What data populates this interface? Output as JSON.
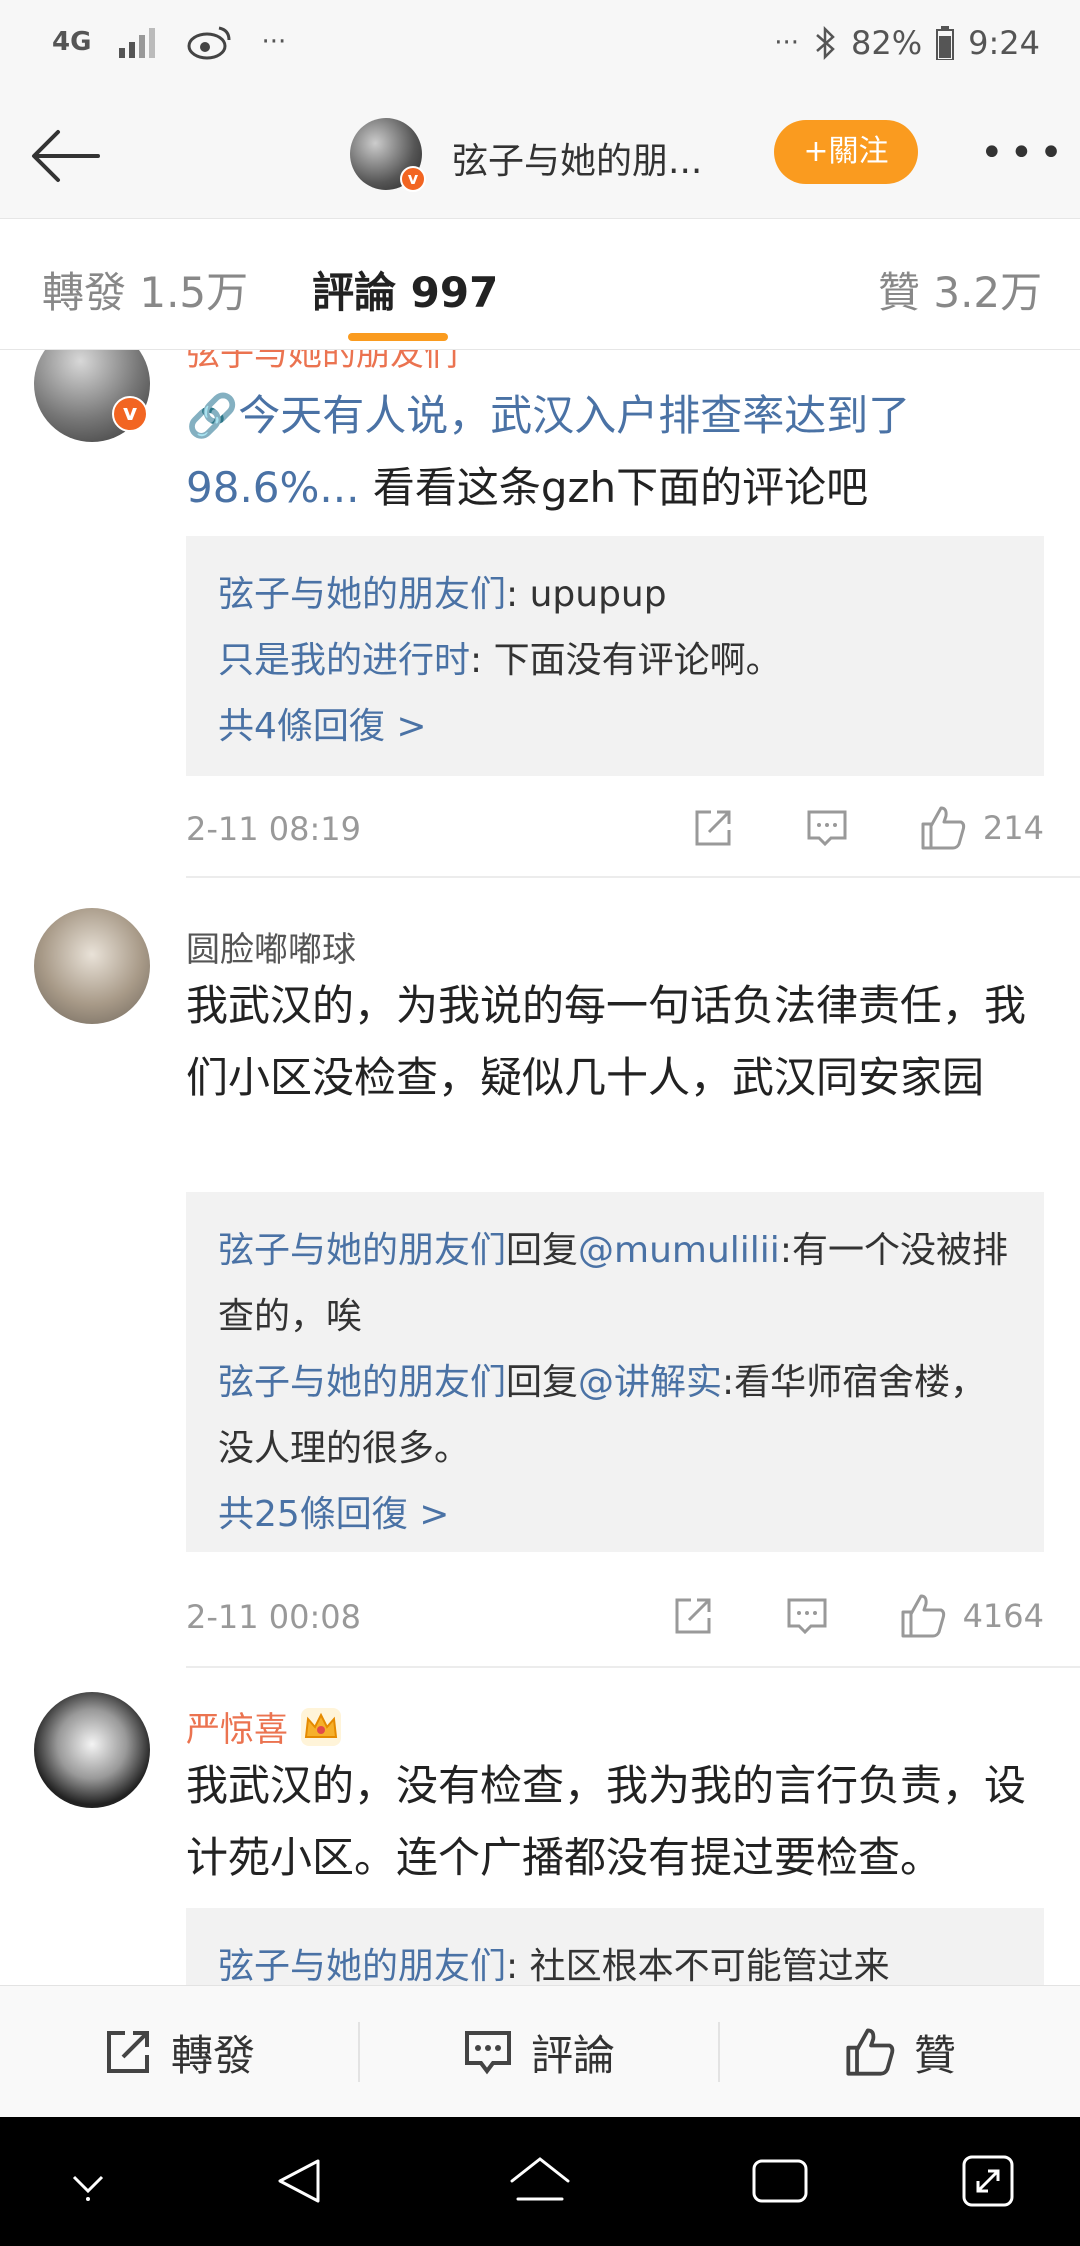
{
  "status_bar": {
    "network": "4G",
    "overflow": "···",
    "overflow_right": "···",
    "battery": "82%",
    "time": "9:24"
  },
  "nav": {
    "title": "弦子与她的朋...",
    "follow_label": "+關注",
    "more_label": "•••"
  },
  "tabs": {
    "repost": "轉發 1.5万",
    "comments": "評論 997",
    "likes": "贊 3.2万"
  },
  "comments": [
    {
      "name": "弦子与她的朋友们",
      "link_text": "今天有人说，武汉入户排查率达到了98.6%...",
      "text": " 看看这条gzh下面的评论吧",
      "replies": [
        {
          "name": "弦子与她的朋友们",
          "sep": ":",
          "text": " upupup"
        },
        {
          "name": "只是我的进行时",
          "sep": ":",
          "text": " 下面没有评论啊。"
        }
      ],
      "more_replies": "共4條回復 >",
      "time": "2-11 08:19",
      "likes": "214"
    },
    {
      "name": "圆脸嘟嘟球",
      "text": "我武汉的，为我说的每一句话负法律责任，我们小区没检查，疑似几十人，武汉同安家园",
      "replies": [
        {
          "name": "弦子与她的朋友们",
          "mid": "回复",
          "at": "@mumulilii",
          "text": ":有一个没被排查的，唉"
        },
        {
          "name": "弦子与她的朋友们",
          "mid": "回复",
          "at": "@讲解实",
          "text": ":看华师宿舍楼，没人理的很多。"
        }
      ],
      "more_replies": "共25條回復 >",
      "time": "2-11 00:08",
      "likes": "4164"
    },
    {
      "name": "严惊喜",
      "text": "我武汉的，没有检查，我为我的言行负责，设计苑小区。连个广播都没有提过要检查。",
      "replies": [
        {
          "name": "弦子与她的朋友们",
          "sep": ":",
          "text": " 社区根本不可能管过来"
        }
      ]
    }
  ],
  "bottom_bar": {
    "repost": "轉發",
    "comment": "評論",
    "like": "贊"
  },
  "colors": {
    "accent": "#fa9b1f",
    "link": "#4a72a5",
    "orange_name": "#eb7350"
  }
}
